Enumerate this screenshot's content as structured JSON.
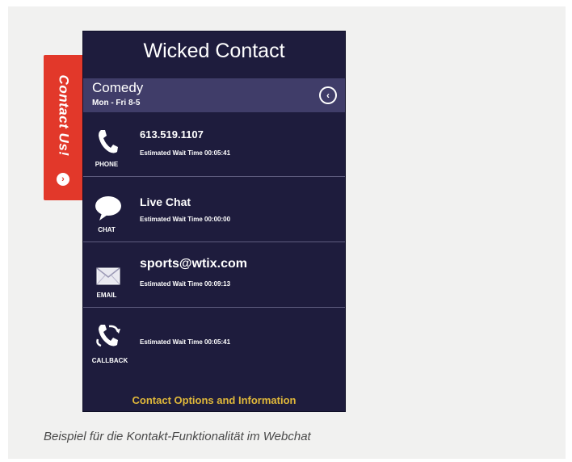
{
  "tab": {
    "label": "Contact Us!",
    "dot_icon": "chevron-right-icon"
  },
  "widget": {
    "title": "Wicked Contact",
    "department": {
      "name": "Comedy",
      "hours": "Mon - Fri 8-5",
      "back_icon": "chevron-left-icon"
    },
    "options": [
      {
        "icon": "phone-icon",
        "label": "PHONE",
        "title": "613.519.1107",
        "wait": "Estimated Wait Time 00:05:41"
      },
      {
        "icon": "chat-bubble-icon",
        "label": "CHAT",
        "title": "Live Chat",
        "wait": "Estimated Wait Time 00:00:00"
      },
      {
        "icon": "envelope-icon",
        "label": "EMAIL",
        "title": "sports@wtix.com",
        "wait": "Estimated Wait Time 00:09:13"
      },
      {
        "icon": "callback-phone-icon",
        "label": "CALLBACK",
        "title": "",
        "wait": "Estimated Wait Time 00:05:41"
      }
    ],
    "footer": "Contact Options and Information"
  },
  "caption": "Beispiel für die Kontakt-Funktionalität im Webchat",
  "colors": {
    "tab": "#e2382a",
    "panel": "#1e1c3d",
    "header_band": "#403d69",
    "footer_text": "#e0b83a",
    "caption_bg": "#f1f1f0"
  }
}
